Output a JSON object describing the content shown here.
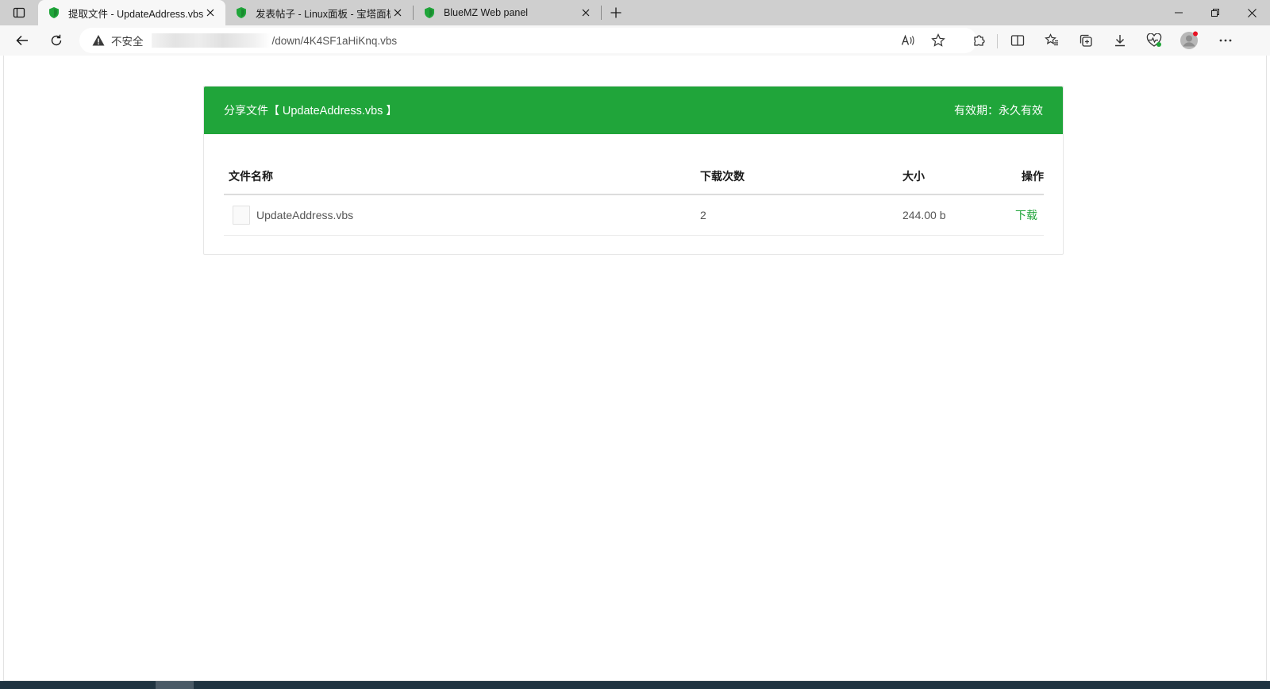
{
  "browser": {
    "tabs": [
      {
        "title": "提取文件 - UpdateAddress.vbs",
        "active": true
      },
      {
        "title": "发表帖子 - Linux面板 - 宝塔面板",
        "active": false
      },
      {
        "title": "BlueMZ Web panel",
        "active": false
      }
    ],
    "address": {
      "security_label": "不安全",
      "url_visible": "/down/4K4SF1aHiKnq.vbs"
    },
    "colors": {
      "favicon": "#20a53a",
      "profile_badge": "#e81123"
    }
  },
  "page": {
    "header": {
      "prefix": "分享文件【 ",
      "filename": "UpdateAddress.vbs",
      "suffix": " 】",
      "validity": "有效期：永久有效"
    },
    "table": {
      "columns": [
        "文件名称",
        "下载次数",
        "大小",
        "操作"
      ],
      "rows": [
        {
          "name": "UpdateAddress.vbs",
          "downloads": "2",
          "size": "244.00 b",
          "action": "下载"
        }
      ]
    },
    "colors": {
      "accent": "#20a53a"
    }
  }
}
